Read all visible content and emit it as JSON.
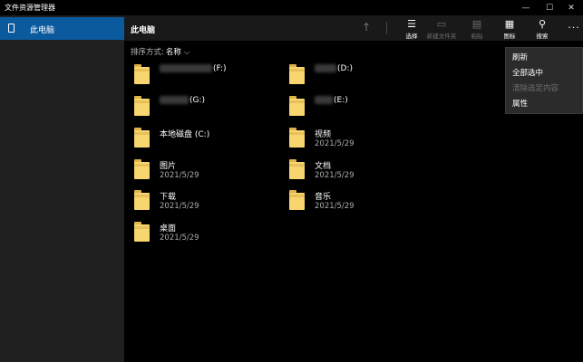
{
  "window": {
    "title": "文件资源管理器",
    "controls": {
      "minimize": "—",
      "maximize": "☐",
      "close": "✕"
    }
  },
  "sidebar": {
    "items": [
      {
        "label": "此电脑",
        "icon": "device-icon",
        "selected": true
      }
    ]
  },
  "header": {
    "location": "此电脑"
  },
  "toolbar": {
    "select_label": "选择",
    "newfolder_label": "新建文件夹",
    "paste_label": "粘贴",
    "icon_label": "图标",
    "search_label": "搜索",
    "more_label": "···"
  },
  "sort": {
    "label": "排序方式:",
    "value": "名称",
    "chevron": "⌵"
  },
  "files": [
    {
      "name": "(F:)",
      "date": ""
    },
    {
      "name": "(D:)",
      "date": ""
    },
    {
      "name": "(G:)",
      "date": ""
    },
    {
      "name": "(E:)",
      "date": ""
    },
    {
      "name": "本地磁盘 (C:)",
      "date": ""
    },
    {
      "name": "视频",
      "date": "2021/5/29"
    },
    {
      "name": "图片",
      "date": "2021/5/29"
    },
    {
      "name": "文档",
      "date": "2021/5/29"
    },
    {
      "name": "下载",
      "date": "2021/5/29"
    },
    {
      "name": "音乐",
      "date": "2021/5/29"
    },
    {
      "name": "桌面",
      "date": "2021/5/29"
    }
  ],
  "context_menu": {
    "items": [
      {
        "label": "刷新",
        "enabled": true
      },
      {
        "label": "全部选中",
        "enabled": true
      },
      {
        "label": "清除选定内容",
        "enabled": false
      },
      {
        "label": "属性",
        "enabled": true
      }
    ]
  },
  "colors": {
    "accent": "#0b5a9d",
    "folder": "#f7d56f",
    "background": "#000000",
    "sidebar": "#1f1f1f"
  }
}
